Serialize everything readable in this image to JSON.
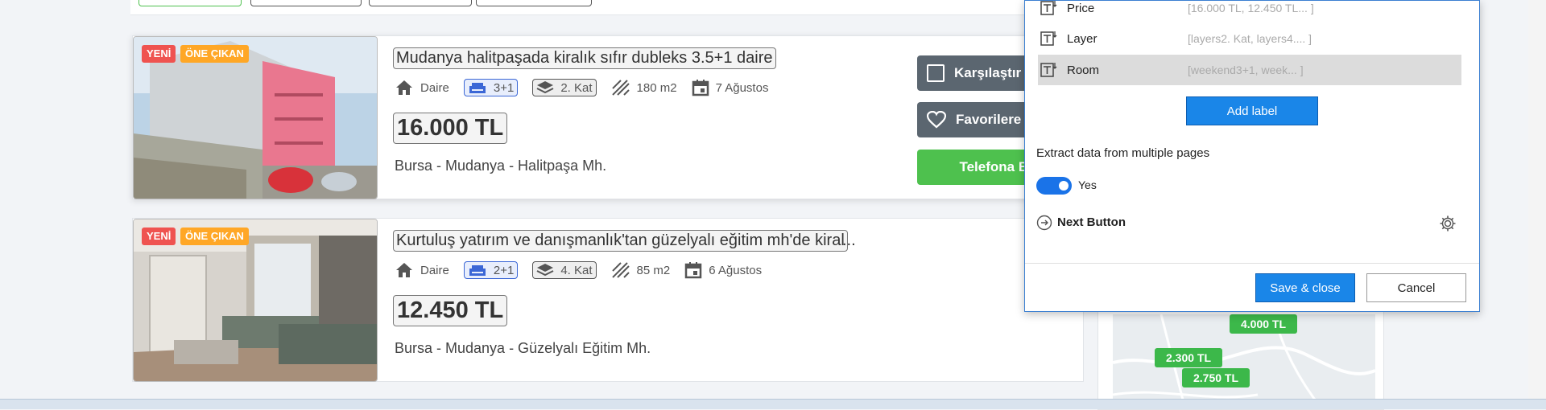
{
  "listings": [
    {
      "badge_new": "YENİ",
      "badge_featured": "ÖNE ÇIKAN",
      "title": "Mudanya halitpaşada kiralık sıfır dubleks 3.5+1 daire",
      "title_rest": "",
      "type": "Daire",
      "rooms": "3+1",
      "floor": "2. Kat",
      "area": "180 m2",
      "date": "7 Ağustos",
      "price": "16.000 TL",
      "location": "Bursa - Mudanya - Halitpaşa Mh."
    },
    {
      "badge_new": "YENİ",
      "badge_featured": "ÖNE ÇIKAN",
      "title": "Kurtuluş yatırım ve danışmanlık'tan güzelyalı eğitim mh'de kiral",
      "title_rest": "...",
      "type": "Daire",
      "rooms": "2+1",
      "floor": "4. Kat",
      "area": "85 m2",
      "date": "6 Ağustos",
      "price": "12.450 TL",
      "location": "Bursa - Mudanya - Güzelyalı Eğitim Mh."
    }
  ],
  "actions": {
    "compare": "Karşılaştır",
    "favorites": "Favorilere",
    "call": "Telefona Ba"
  },
  "map": {
    "pins": [
      "4.000 TL",
      "2.300 TL",
      "2.750 TL"
    ]
  },
  "dialog": {
    "labels": [
      {
        "name": "Price",
        "value": "[16.000 TL, 12.450 TL... ]"
      },
      {
        "name": "Layer",
        "value": "[layers2. Kat, layers4.... ]"
      },
      {
        "name": "Room",
        "value": "[weekend3+1, week...  ]"
      }
    ],
    "add_label": "Add label",
    "multi_page_heading": "Extract data from multiple pages",
    "toggle_label": "Yes",
    "next_button": "Next Button",
    "save_close": "Save & close",
    "cancel": "Cancel"
  }
}
